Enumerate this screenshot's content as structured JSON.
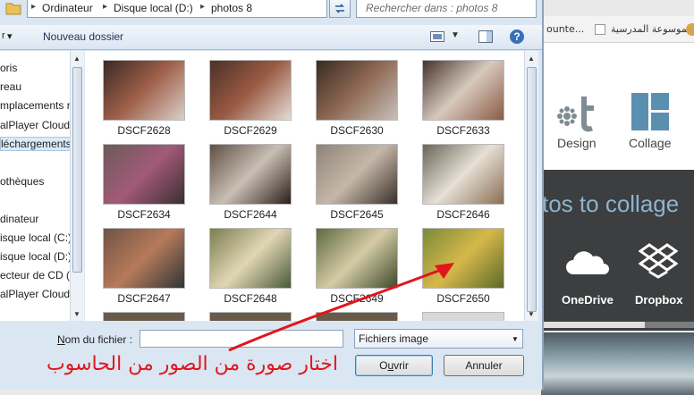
{
  "dialog": {
    "breadcrumb": [
      "Ordinateur",
      "Disque local (D:)",
      "photos 8"
    ],
    "search_placeholder": "Rechercher dans : photos 8",
    "toolbar": {
      "organize_label": "r",
      "new_folder_label": "Nouveau dossier"
    },
    "nav_items": [
      {
        "label": "oris"
      },
      {
        "label": "reau"
      },
      {
        "label": "mplacements ré"
      },
      {
        "label": "alPlayer Cloud"
      },
      {
        "label": "léchargements"
      },
      {
        "label": "othèques"
      },
      {
        "label": "dinateur"
      },
      {
        "label": "isque local (C:)"
      },
      {
        "label": "isque local (D:)"
      },
      {
        "label": "ecteur de CD (F:"
      },
      {
        "label": "alPlayer Cloud"
      }
    ],
    "files": [
      {
        "name": "DSCF2628"
      },
      {
        "name": "DSCF2629"
      },
      {
        "name": "DSCF2630"
      },
      {
        "name": "DSCF2633"
      },
      {
        "name": "DSCF2634"
      },
      {
        "name": "DSCF2644"
      },
      {
        "name": "DSCF2645"
      },
      {
        "name": "DSCF2646"
      },
      {
        "name": "DSCF2647"
      },
      {
        "name": "DSCF2648"
      },
      {
        "name": "DSCF2649"
      },
      {
        "name": "DSCF2650"
      }
    ],
    "filename_label_prefix": "N",
    "filename_label_rest": "om du fichier :",
    "filename_value": "",
    "filetype_value": "Fichiers image",
    "open_accel": "u",
    "open_label_pre": "O",
    "open_label_post": "vrir",
    "cancel_label": "Annuler"
  },
  "background": {
    "bookmark1": "ounte...",
    "bookmark2": "الموسوعة المدرسية",
    "design_label": "Design",
    "collage_label": "Collage",
    "banner_text": "tos to collage",
    "onedrive_label": "OneDrive",
    "dropbox_label": "Dropbox",
    "progress": 0.68
  },
  "annotation": {
    "text": "اختار صورة من الصور من الحاسوب",
    "color": "#e0161b"
  }
}
